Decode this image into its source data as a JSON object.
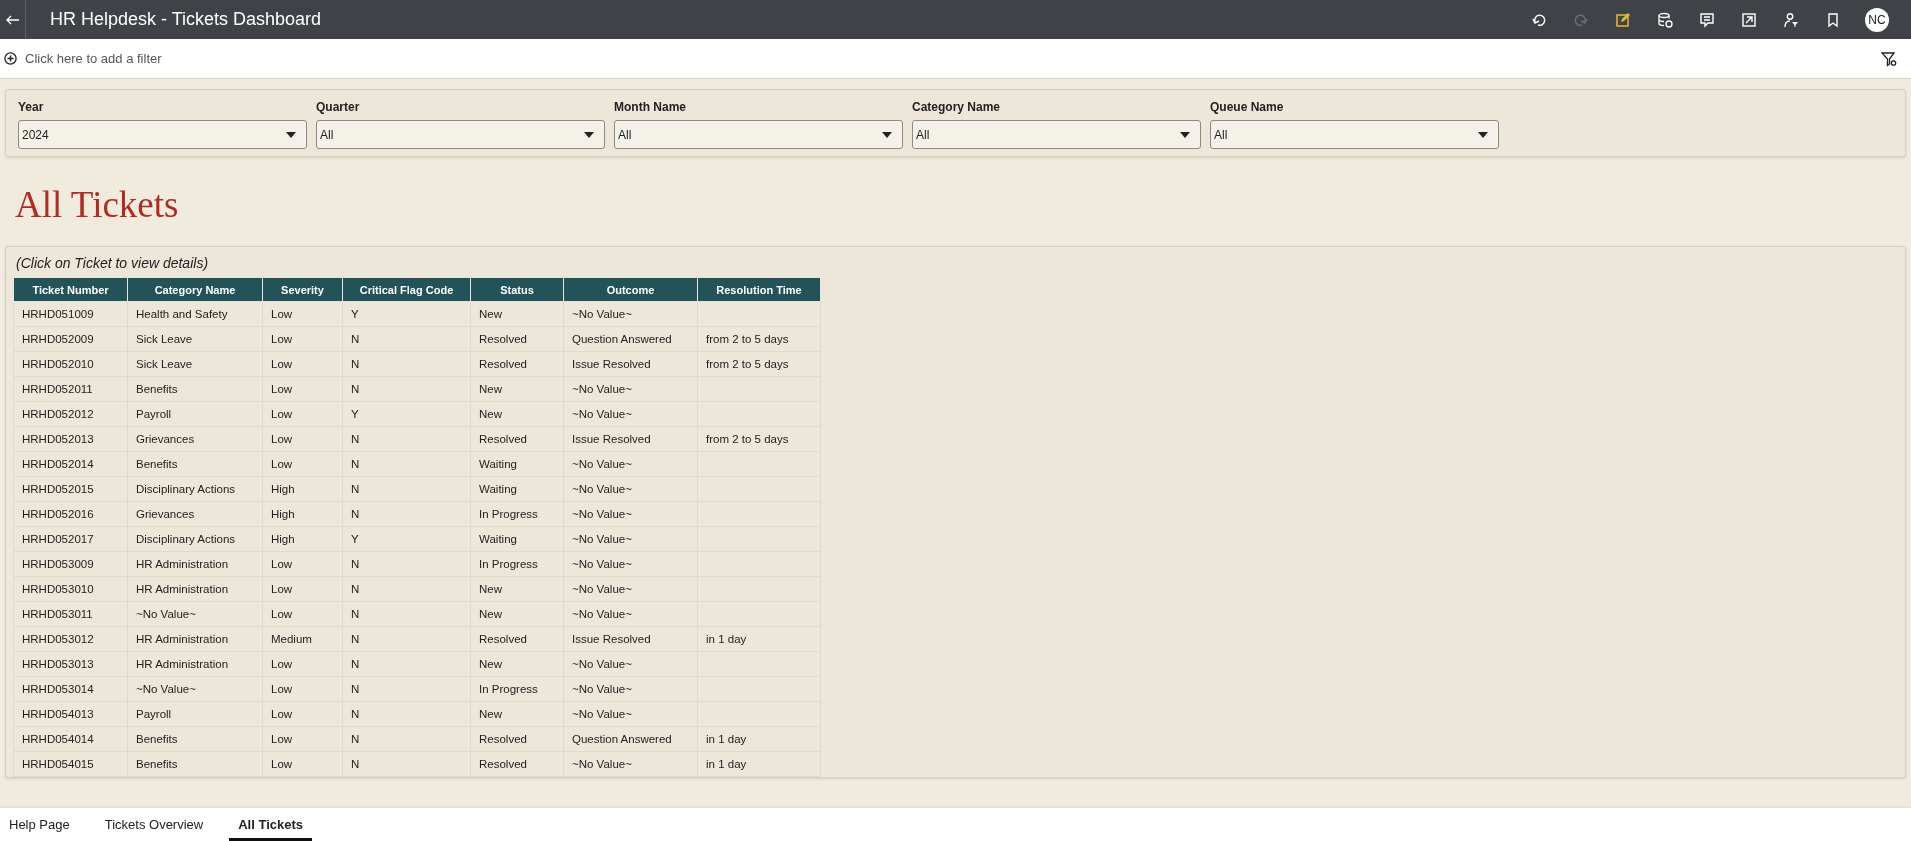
{
  "header": {
    "title": "HR Helpdesk - Tickets Dashboard",
    "toolbar": [
      {
        "kind": "undo",
        "disabled": false
      },
      {
        "kind": "redo",
        "disabled": true
      },
      {
        "kind": "edit",
        "disabled": false
      },
      {
        "kind": "data",
        "disabled": false
      },
      {
        "kind": "comment",
        "disabled": false
      },
      {
        "kind": "export",
        "disabled": false
      },
      {
        "kind": "user-filter",
        "disabled": false
      },
      {
        "kind": "bookmark",
        "disabled": false
      }
    ],
    "avatar": "NC"
  },
  "filter_bar": {
    "placeholder": "Click here to add a filter"
  },
  "filters": [
    {
      "label": "Year",
      "value": "2024"
    },
    {
      "label": "Quarter",
      "value": "All"
    },
    {
      "label": "Month Name",
      "value": "All"
    },
    {
      "label": "Category Name",
      "value": "All"
    },
    {
      "label": "Queue Name",
      "value": "All"
    }
  ],
  "page_title": "All Tickets",
  "table": {
    "caption": "(Click on Ticket to view details)",
    "columns": [
      "Ticket Number",
      "Category Name",
      "Severity",
      "Critical Flag Code",
      "Status",
      "Outcome",
      "Resolution Time"
    ],
    "rows": [
      [
        "HRHD051009",
        "Health and Safety",
        "Low",
        "Y",
        "New",
        "~No Value~",
        ""
      ],
      [
        "HRHD052009",
        "Sick Leave",
        "Low",
        "N",
        "Resolved",
        "Question Answered",
        "from 2 to 5 days"
      ],
      [
        "HRHD052010",
        "Sick Leave",
        "Low",
        "N",
        "Resolved",
        "Issue Resolved",
        "from 2 to 5 days"
      ],
      [
        "HRHD052011",
        "Benefits",
        "Low",
        "N",
        "New",
        "~No Value~",
        ""
      ],
      [
        "HRHD052012",
        "Payroll",
        "Low",
        "Y",
        "New",
        "~No Value~",
        ""
      ],
      [
        "HRHD052013",
        "Grievances",
        "Low",
        "N",
        "Resolved",
        "Issue Resolved",
        "from 2 to 5 days"
      ],
      [
        "HRHD052014",
        "Benefits",
        "Low",
        "N",
        "Waiting",
        "~No Value~",
        ""
      ],
      [
        "HRHD052015",
        "Disciplinary Actions",
        "High",
        "N",
        "Waiting",
        "~No Value~",
        ""
      ],
      [
        "HRHD052016",
        "Grievances",
        "High",
        "N",
        "In Progress",
        "~No Value~",
        ""
      ],
      [
        "HRHD052017",
        "Disciplinary Actions",
        "High",
        "Y",
        "Waiting",
        "~No Value~",
        ""
      ],
      [
        "HRHD053009",
        "HR Administration",
        "Low",
        "N",
        "In Progress",
        "~No Value~",
        ""
      ],
      [
        "HRHD053010",
        "HR Administration",
        "Low",
        "N",
        "New",
        "~No Value~",
        ""
      ],
      [
        "HRHD053011",
        "~No Value~",
        "Low",
        "N",
        "New",
        "~No Value~",
        ""
      ],
      [
        "HRHD053012",
        "HR Administration",
        "Medium",
        "N",
        "Resolved",
        "Issue Resolved",
        "in 1 day"
      ],
      [
        "HRHD053013",
        "HR Administration",
        "Low",
        "N",
        "New",
        "~No Value~",
        ""
      ],
      [
        "HRHD053014",
        "~No Value~",
        "Low",
        "N",
        "In Progress",
        "~No Value~",
        ""
      ],
      [
        "HRHD054013",
        "Payroll",
        "Low",
        "N",
        "New",
        "~No Value~",
        ""
      ],
      [
        "HRHD054014",
        "Benefits",
        "Low",
        "N",
        "Resolved",
        "Question Answered",
        "in 1 day"
      ],
      [
        "HRHD054015",
        "Benefits",
        "Low",
        "N",
        "Resolved",
        "~No Value~",
        "in 1 day"
      ]
    ]
  },
  "page_tabs": [
    {
      "label": "Help Page",
      "selected": false
    },
    {
      "label": "Tickets Overview",
      "selected": false
    },
    {
      "label": "All Tickets",
      "selected": true
    }
  ]
}
